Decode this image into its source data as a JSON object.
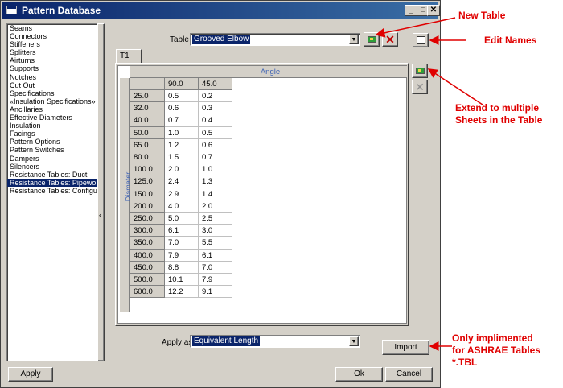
{
  "window": {
    "title": "Pattern Database",
    "minimize": "_",
    "maximize": "□",
    "close": "✕"
  },
  "sidebar": {
    "items": [
      "Seams",
      "Connectors",
      "Stiffeners",
      "Splitters",
      "Airturns",
      "Supports",
      "Notches",
      "Cut Out",
      "Specifications",
      "«Insulation Specifications»",
      "Ancillaries",
      "Effective Diameters",
      "Insulation",
      "Facings",
      "Pattern Options",
      "Pattern Switches",
      "Dampers",
      "Silencers",
      "Resistance Tables: Duct",
      "Resistance Tables: Pipework",
      "Resistance Tables: Configura"
    ],
    "selected_index": 19,
    "collapse_glyph": "‹"
  },
  "table_selector": {
    "label": "Table",
    "value": "Grooved Elbow"
  },
  "tabs": [
    {
      "label": "T1"
    }
  ],
  "grid": {
    "group_header": "Angle",
    "row_axis_label": "Diameter",
    "columns": [
      "90.0",
      "45.0"
    ],
    "rows": [
      {
        "d": "25.0",
        "v": [
          "0.5",
          "0.2"
        ]
      },
      {
        "d": "32.0",
        "v": [
          "0.6",
          "0.3"
        ]
      },
      {
        "d": "40.0",
        "v": [
          "0.7",
          "0.4"
        ]
      },
      {
        "d": "50.0",
        "v": [
          "1.0",
          "0.5"
        ]
      },
      {
        "d": "65.0",
        "v": [
          "1.2",
          "0.6"
        ]
      },
      {
        "d": "80.0",
        "v": [
          "1.5",
          "0.7"
        ]
      },
      {
        "d": "100.0",
        "v": [
          "2.0",
          "1.0"
        ]
      },
      {
        "d": "125.0",
        "v": [
          "2.4",
          "1.3"
        ]
      },
      {
        "d": "150.0",
        "v": [
          "2.9",
          "1.4"
        ]
      },
      {
        "d": "200.0",
        "v": [
          "4.0",
          "2.0"
        ]
      },
      {
        "d": "250.0",
        "v": [
          "5.0",
          "2.5"
        ]
      },
      {
        "d": "300.0",
        "v": [
          "6.1",
          "3.0"
        ]
      },
      {
        "d": "350.0",
        "v": [
          "7.0",
          "5.5"
        ]
      },
      {
        "d": "400.0",
        "v": [
          "7.9",
          "6.1"
        ]
      },
      {
        "d": "450.0",
        "v": [
          "8.8",
          "7.0"
        ]
      },
      {
        "d": "500.0",
        "v": [
          "10.1",
          "7.9"
        ]
      },
      {
        "d": "600.0",
        "v": [
          "12.2",
          "9.1"
        ]
      }
    ]
  },
  "apply_as": {
    "label": "Apply as",
    "value": "Equivalent Length"
  },
  "buttons": {
    "import": "Import",
    "apply": "Apply",
    "ok": "Ok",
    "cancel": "Cancel"
  },
  "annotations": {
    "new_table": "New Table",
    "edit_names": "Edit Names",
    "extend_line1": "Extend to multiple",
    "extend_line2": "Sheets in the Table",
    "only_line1": "Only implimented",
    "only_line2": "for ASHRAE Tables",
    "only_line3": "*.TBL"
  },
  "colors": {
    "annotation": "#e00000",
    "selection": "#0a246a",
    "axis_label": "#3d62b4"
  }
}
